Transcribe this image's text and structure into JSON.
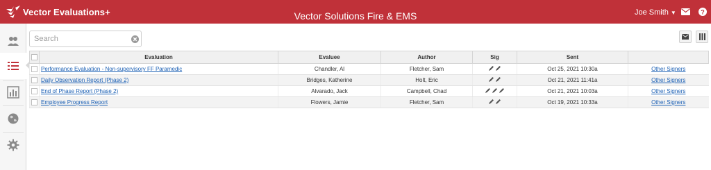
{
  "header": {
    "brand": "Vector Evaluations+",
    "app_title": "Vector Solutions Fire & EMS",
    "user_name": "Joe Smith",
    "colors": {
      "bar": "#c03139",
      "link": "#1a5fb4"
    }
  },
  "sidebar": {
    "items": [
      {
        "icon": "users-icon",
        "active": false
      },
      {
        "icon": "list-icon",
        "active": true
      },
      {
        "icon": "bar-chart-icon",
        "active": false
      },
      {
        "icon": "globe-icon",
        "active": false
      },
      {
        "icon": "gear-icon",
        "active": false
      }
    ]
  },
  "toolbar": {
    "search_placeholder": "Search",
    "search_value": "",
    "buttons": [
      "mail-icon",
      "columns-icon"
    ]
  },
  "table": {
    "columns": [
      "Evaluation",
      "Evaluee",
      "Author",
      "Sig",
      "Sent",
      ""
    ],
    "rows": [
      {
        "evaluation": "Performance Evaluation - Non-supervisory FF Paramedic",
        "evaluee": "Chandler, Al",
        "author": "Fletcher, Sam",
        "sig_count": 2,
        "sent": "Oct 25, 2021 10:30a",
        "signers": "Other Signers"
      },
      {
        "evaluation": "Daily Observation Report (Phase 2)",
        "evaluee": "Bridges, Katherine",
        "author": "Holt, Eric",
        "sig_count": 2,
        "sent": "Oct 21, 2021 11:41a",
        "signers": "Other Signers"
      },
      {
        "evaluation": "End of Phase Report (Phase 2)",
        "evaluee": "Alvarado, Jack",
        "author": "Campbell, Chad",
        "sig_count": 3,
        "sent": "Oct 21, 2021 10:03a",
        "signers": "Other Signers"
      },
      {
        "evaluation": "Employee Progress Report",
        "evaluee": "Flowers, Jamie",
        "author": "Fletcher, Sam",
        "sig_count": 2,
        "sent": "Oct 19, 2021 10:33a",
        "signers": "Other Signers"
      }
    ]
  }
}
